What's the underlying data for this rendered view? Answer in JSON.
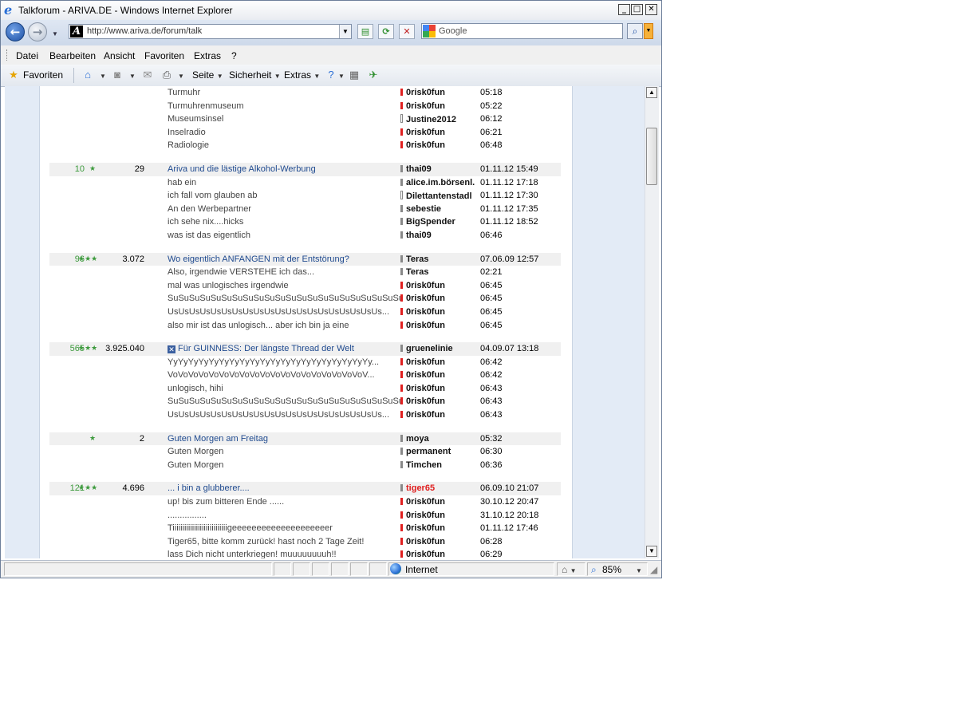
{
  "window": {
    "title": "Talkforum - ARIVA.DE - Windows Internet Explorer",
    "min": "_",
    "max": "□",
    "close": "✕"
  },
  "address": {
    "url": "http://www.ariva.de/forum/talk",
    "search_placeholder": "Google"
  },
  "menu": [
    "Datei",
    "Bearbeiten",
    "Ansicht",
    "Favoriten",
    "Extras",
    "?"
  ],
  "commandbar": {
    "favorites": "Favoriten",
    "page": "Seite",
    "security": "Sicherheit",
    "extras": "Extras"
  },
  "status": {
    "zone": "Internet",
    "zoom": "85%"
  },
  "forum": {
    "threads": [
      {
        "head": null,
        "replies": [
          {
            "title": "Turmuhr",
            "user": "0risk0fun",
            "time": "05:18",
            "marker": "red"
          },
          {
            "title": "Turmuhrenmuseum",
            "user": "0risk0fun",
            "time": "05:22",
            "marker": "red"
          },
          {
            "title": "Museumsinsel",
            "user": "Justine2012",
            "time": "06:12",
            "marker": "hollow"
          },
          {
            "title": "Inselradio",
            "user": "0risk0fun",
            "time": "06:21",
            "marker": "red"
          },
          {
            "title": "Radiologie",
            "user": "0risk0fun",
            "time": "06:48",
            "marker": "red"
          }
        ]
      },
      {
        "head": {
          "count": "10",
          "stars": "★",
          "posts": "29",
          "title": "Ariva und die lästige Alkohol-Werbung",
          "user": "thai09",
          "time": "01.11.12 15:49",
          "marker": "grey",
          "closed": false
        },
        "replies": [
          {
            "title": "hab ein",
            "user": "alice.im.börsenl.",
            "time": "01.11.12 17:18",
            "marker": "grey"
          },
          {
            "title": "ich fall vom glauben ab",
            "user": "Dilettantenstadl",
            "time": "01.11.12 17:30",
            "marker": "hollow"
          },
          {
            "title": "An den Werbepartner",
            "user": "sebestie",
            "time": "01.11.12 17:35",
            "marker": "grey"
          },
          {
            "title": "ich sehe nix....hicks",
            "user": "BigSpender",
            "time": "01.11.12 18:52",
            "marker": "grey"
          },
          {
            "title": "was ist das eigentlich",
            "user": "thai09",
            "time": "06:46",
            "marker": "grey"
          }
        ]
      },
      {
        "head": {
          "count": "96",
          "stars": "★★★",
          "posts": "3.072",
          "title": "Wo eigentlich ANFANGEN mit der Entstörung?",
          "user": "Teras",
          "time": "07.06.09 12:57",
          "marker": "grey",
          "closed": false
        },
        "replies": [
          {
            "title": "Also, irgendwie VERSTEHE ich das...",
            "user": "Teras",
            "time": "02:21",
            "marker": "grey"
          },
          {
            "title": "mal was unlogisches irgendwie",
            "user": "0risk0fun",
            "time": "06:45",
            "marker": "red"
          },
          {
            "title": "SuSuSuSuSuSuSuSuSuSuSuSuSuSuSuSuSuSuSuSuSuSu...",
            "user": "0risk0fun",
            "time": "06:45",
            "marker": "red"
          },
          {
            "title": "UsUsUsUsUsUsUsUsUsUsUsUsUsUsUsUsUsUsUsUs...",
            "user": "0risk0fun",
            "time": "06:45",
            "marker": "red"
          },
          {
            "title": "also mir ist das unlogisch... aber ich bin ja eine",
            "user": "0risk0fun",
            "time": "06:45",
            "marker": "red"
          }
        ]
      },
      {
        "head": {
          "count": "565",
          "stars": "★★★",
          "posts": "3.925.040",
          "title": "Für GUINNESS: Der längste Thread der Welt",
          "user": "gruenelinie",
          "time": "04.09.07 13:18",
          "marker": "grey",
          "closed": true
        },
        "replies": [
          {
            "title": "YyYyYyYyYyYyYyYyYyYyYyYyYyYyYyYyYyYyYyYy...",
            "user": "0risk0fun",
            "time": "06:42",
            "marker": "red"
          },
          {
            "title": "VoVoVoVoVoVoVoVoVoVoVoVoVoVoVoVoVoVoVoV...",
            "user": "0risk0fun",
            "time": "06:42",
            "marker": "red"
          },
          {
            "title": "unlogisch, hihi",
            "user": "0risk0fun",
            "time": "06:43",
            "marker": "red"
          },
          {
            "title": "SuSuSuSuSuSuSuSuSuSuSuSuSuSuSuSuSuSuSuSuSuSu...",
            "user": "0risk0fun",
            "time": "06:43",
            "marker": "red"
          },
          {
            "title": "UsUsUsUsUsUsUsUsUsUsUsUsUsUsUsUsUsUsUsUs...",
            "user": "0risk0fun",
            "time": "06:43",
            "marker": "red"
          }
        ]
      },
      {
        "head": {
          "count": "",
          "stars": "★",
          "posts": "2",
          "title": "Guten Morgen am Freitag",
          "user": "moya",
          "time": "05:32",
          "marker": "grey",
          "closed": false
        },
        "replies": [
          {
            "title": "Guten Morgen",
            "user": "permanent",
            "time": "06:30",
            "marker": "grey"
          },
          {
            "title": "Guten Morgen",
            "user": "Timchen",
            "time": "06:36",
            "marker": "grey"
          }
        ]
      },
      {
        "head": {
          "count": "121",
          "stars": "★★★",
          "posts": "4.696",
          "title": "... i bin a glubberer....",
          "user": "tiger65",
          "time": "06.09.10 21:07",
          "marker": "grey",
          "closed": false,
          "user_red": true
        },
        "replies": [
          {
            "title": "up! bis zum bitteren Ende ......",
            "user": "0risk0fun",
            "time": "30.10.12 20:47",
            "marker": "red"
          },
          {
            "title": "................",
            "user": "0risk0fun",
            "time": "31.10.12 20:18",
            "marker": "red"
          },
          {
            "title": "Tiiiiiiiiiiiiiiiiiiiiiiiiiiiigeeeeeeeeeeeeeeeeeeeer",
            "user": "0risk0fun",
            "time": "01.11.12 17:46",
            "marker": "red"
          },
          {
            "title": "Tiger65, bitte komm zurück! hast noch 2 Tage Zeit!",
            "user": "0risk0fun",
            "time": "06:28",
            "marker": "red"
          },
          {
            "title": "lass Dich nicht unterkriegen! muuuuuuuuh!!",
            "user": "0risk0fun",
            "time": "06:29",
            "marker": "red"
          }
        ]
      }
    ]
  }
}
